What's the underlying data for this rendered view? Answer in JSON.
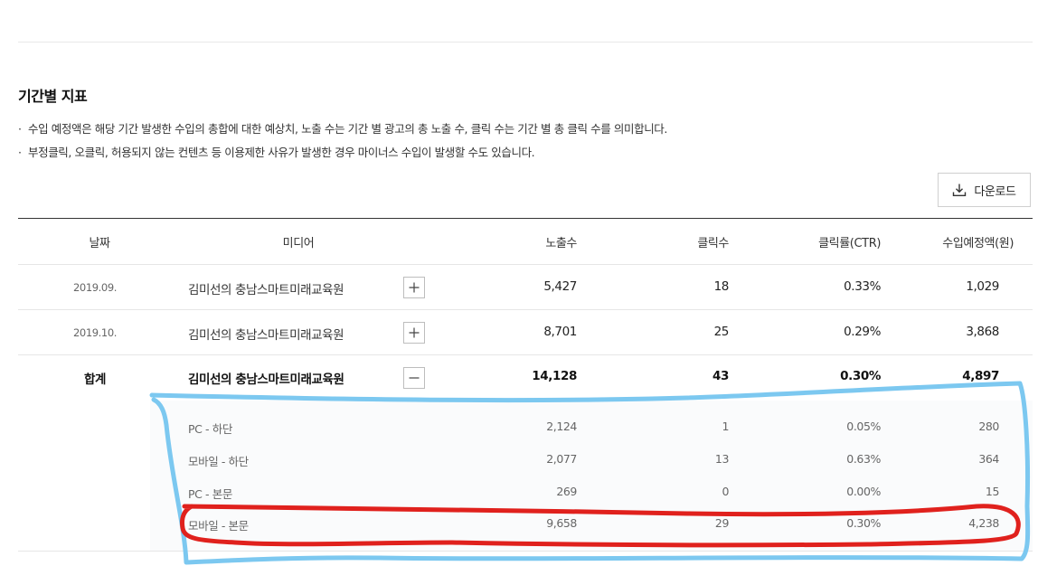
{
  "section": {
    "title": "기간별 지표",
    "notes": [
      "수입 예정액은 해당 기간 발생한 수입의 총합에 대한 예상치, 노출 수는 기간 별 광고의 총 노출 수, 클릭 수는 기간 별 총 클릭 수를 의미합니다.",
      "부정클릭, 오클릭, 허용되지 않는 컨텐츠 등 이용제한 사유가 발생한 경우 마이너스 수입이 발생할 수도 있습니다."
    ],
    "note_bullet": "·"
  },
  "toolbar": {
    "download_label": "다운로드",
    "download_icon": "download-icon"
  },
  "table": {
    "headers": [
      "날짜",
      "미디어",
      "노출수",
      "클릭수",
      "클릭률(CTR)",
      "수입예정액(원)"
    ],
    "rows": [
      {
        "date": "2019.09.",
        "media": "김미선의 충남스마트미래교육원",
        "toggle": "+",
        "impressions": "5,427",
        "clicks": "18",
        "ctr": "0.33%",
        "revenue": "1,029"
      },
      {
        "date": "2019.10.",
        "media": "김미선의 충남스마트미래교육원",
        "toggle": "+",
        "impressions": "8,701",
        "clicks": "25",
        "ctr": "0.29%",
        "revenue": "3,868"
      }
    ],
    "total": {
      "label": "합계",
      "media": "김미선의 충남스마트미래교육원",
      "toggle": "−",
      "impressions": "14,128",
      "clicks": "43",
      "ctr": "0.30%",
      "revenue": "4,897"
    },
    "details": [
      {
        "name": "PC - 하단",
        "impressions": "2,124",
        "clicks": "1",
        "ctr": "0.05%",
        "revenue": "280"
      },
      {
        "name": "모바일 - 하단",
        "impressions": "2,077",
        "clicks": "13",
        "ctr": "0.63%",
        "revenue": "364"
      },
      {
        "name": "PC - 본문",
        "impressions": "269",
        "clicks": "0",
        "ctr": "0.00%",
        "revenue": "15"
      },
      {
        "name": "모바일 - 본문",
        "impressions": "9,658",
        "clicks": "29",
        "ctr": "0.30%",
        "revenue": "4,238"
      }
    ]
  },
  "annotations": {
    "blue_color": "#7cc8f0",
    "red_color": "#e0211d"
  }
}
